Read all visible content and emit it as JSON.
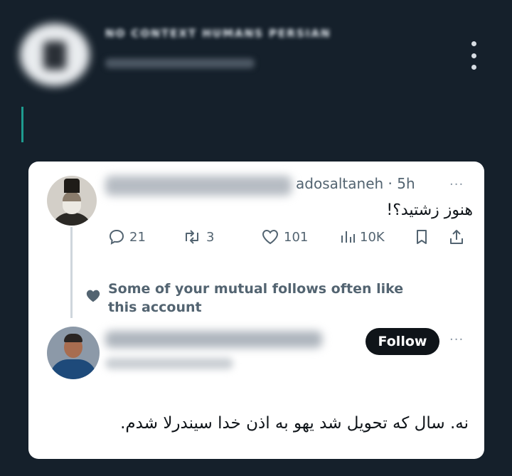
{
  "header": {
    "account_name": "NO CONTEXT HUMANS PERSIAN"
  },
  "post": {
    "handle_time": "adosaltaneh · 5h",
    "text": "هنوز زشتید؟!",
    "stats": {
      "replies": "21",
      "reposts": "3",
      "likes": "101",
      "views": "10K"
    },
    "more_label": "···"
  },
  "mutual_notice": "Some of your mutual follows often like this account",
  "reply": {
    "follow_label": "Follow",
    "more_label": "···",
    "text": "نه. سال که تحویل شد یهو به اذن خدا سیندرلا شدم."
  },
  "colors": {
    "background": "#15202b",
    "card": "#ffffff",
    "secondary_text": "#536471",
    "accent_line": "#1e9b8f"
  }
}
